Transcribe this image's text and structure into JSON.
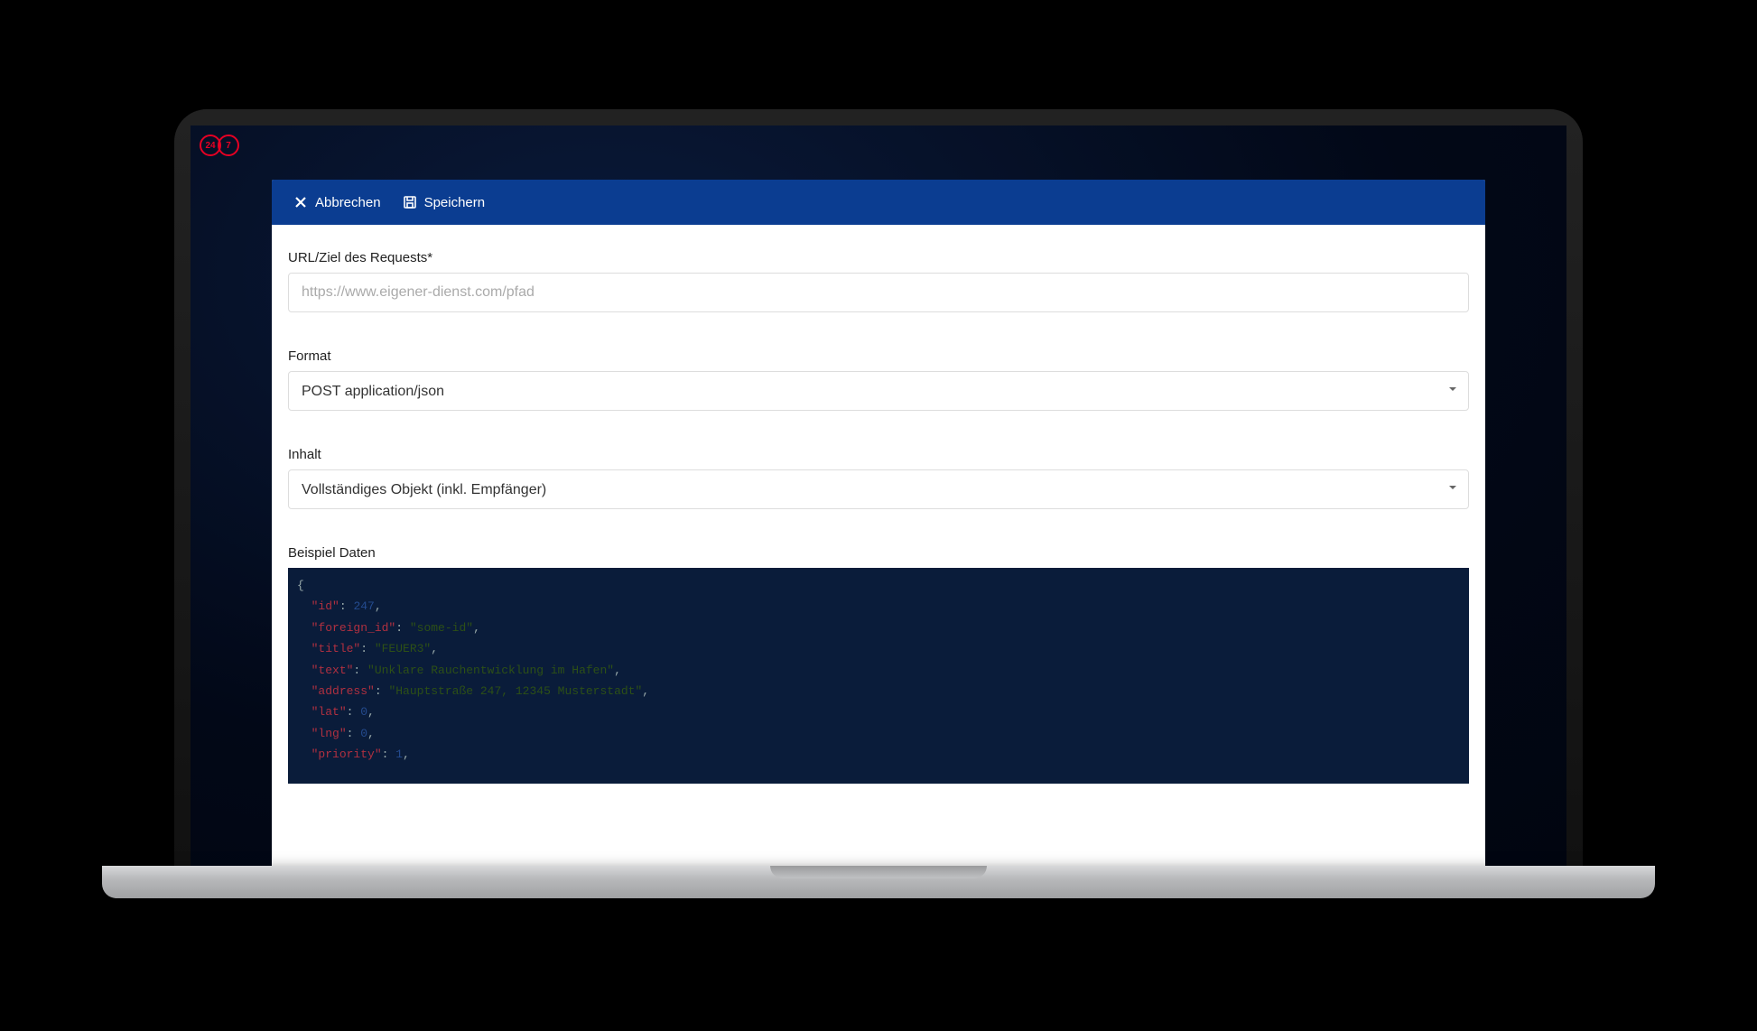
{
  "logo": {
    "left": "24",
    "right": "7"
  },
  "toolbar": {
    "cancel_label": "Abbrechen",
    "save_label": "Speichern"
  },
  "form": {
    "url_label": "URL/Ziel des Requests*",
    "url_placeholder": "https://www.eigener-dienst.com/pfad",
    "format_label": "Format",
    "format_value": "POST application/json",
    "content_label": "Inhalt",
    "content_value": "Vollständiges Objekt (inkl. Empfänger)",
    "example_label": "Beispiel Daten"
  },
  "example": {
    "brace_open": "{",
    "lines": [
      {
        "key": "\"id\"",
        "val": "247",
        "type": "num",
        "comma": ","
      },
      {
        "key": "\"foreign_id\"",
        "val": "\"some-id\"",
        "type": "str",
        "comma": ","
      },
      {
        "key": "\"title\"",
        "val": "\"FEUER3\"",
        "type": "str",
        "comma": ","
      },
      {
        "key": "\"text\"",
        "val": "\"Unklare Rauchentwicklung im Hafen\"",
        "type": "str",
        "comma": ","
      },
      {
        "key": "\"address\"",
        "val": "\"Hauptstraße 247, 12345 Musterstadt\"",
        "type": "str",
        "comma": ","
      },
      {
        "key": "\"lat\"",
        "val": "0",
        "type": "num",
        "comma": ","
      },
      {
        "key": "\"lng\"",
        "val": "0",
        "type": "num",
        "comma": ","
      },
      {
        "key": "\"priority\"",
        "val": "1",
        "type": "num",
        "comma": ","
      }
    ]
  }
}
